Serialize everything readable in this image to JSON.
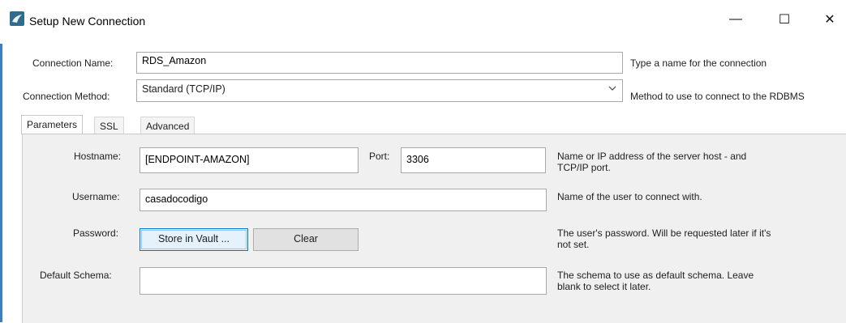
{
  "window": {
    "title": "Setup New Connection",
    "minimize_symbol": "—",
    "maximize_symbol": "☐",
    "close_symbol": "✕"
  },
  "form": {
    "connection_name_label": "Connection Name:",
    "connection_name_value": "RDS_Amazon",
    "connection_name_help": "Type a name for the connection",
    "connection_method_label": "Connection Method:",
    "connection_method_value": "Standard (TCP/IP)",
    "connection_method_help": "Method to use to connect to the RDBMS"
  },
  "tabs": [
    {
      "label": "Parameters",
      "active": true
    },
    {
      "label": "SSL",
      "active": false
    },
    {
      "label": "Advanced",
      "active": false
    }
  ],
  "parameters": {
    "hostname_label": "Hostname:",
    "hostname_value": "[ENDPOINT-AMAZON]",
    "port_label": "Port:",
    "port_value": "3306",
    "hostname_help_line1": "Name or IP address of the server host - and",
    "hostname_help_line2": "TCP/IP port.",
    "username_label": "Username:",
    "username_value": "casadocodigo",
    "username_help": "Name of the user to connect with.",
    "password_label": "Password:",
    "store_in_vault_label": "Store in Vault ...",
    "clear_label": "Clear",
    "password_help_line1": "The user's password. Will be requested later if it's",
    "password_help_line2": "not set.",
    "default_schema_label": "Default Schema:",
    "default_schema_value": "",
    "default_schema_help_line1": "The schema to use as default schema. Leave",
    "default_schema_help_line2": "blank to select it later."
  },
  "colors": {
    "accent": "#0078d7",
    "panel_bg": "#f0f0f0",
    "left_accent": "#3c7fc1"
  },
  "icons": {
    "app": "mysql-workbench-dolphin-icon",
    "dropdown": "chevron-down-icon"
  }
}
